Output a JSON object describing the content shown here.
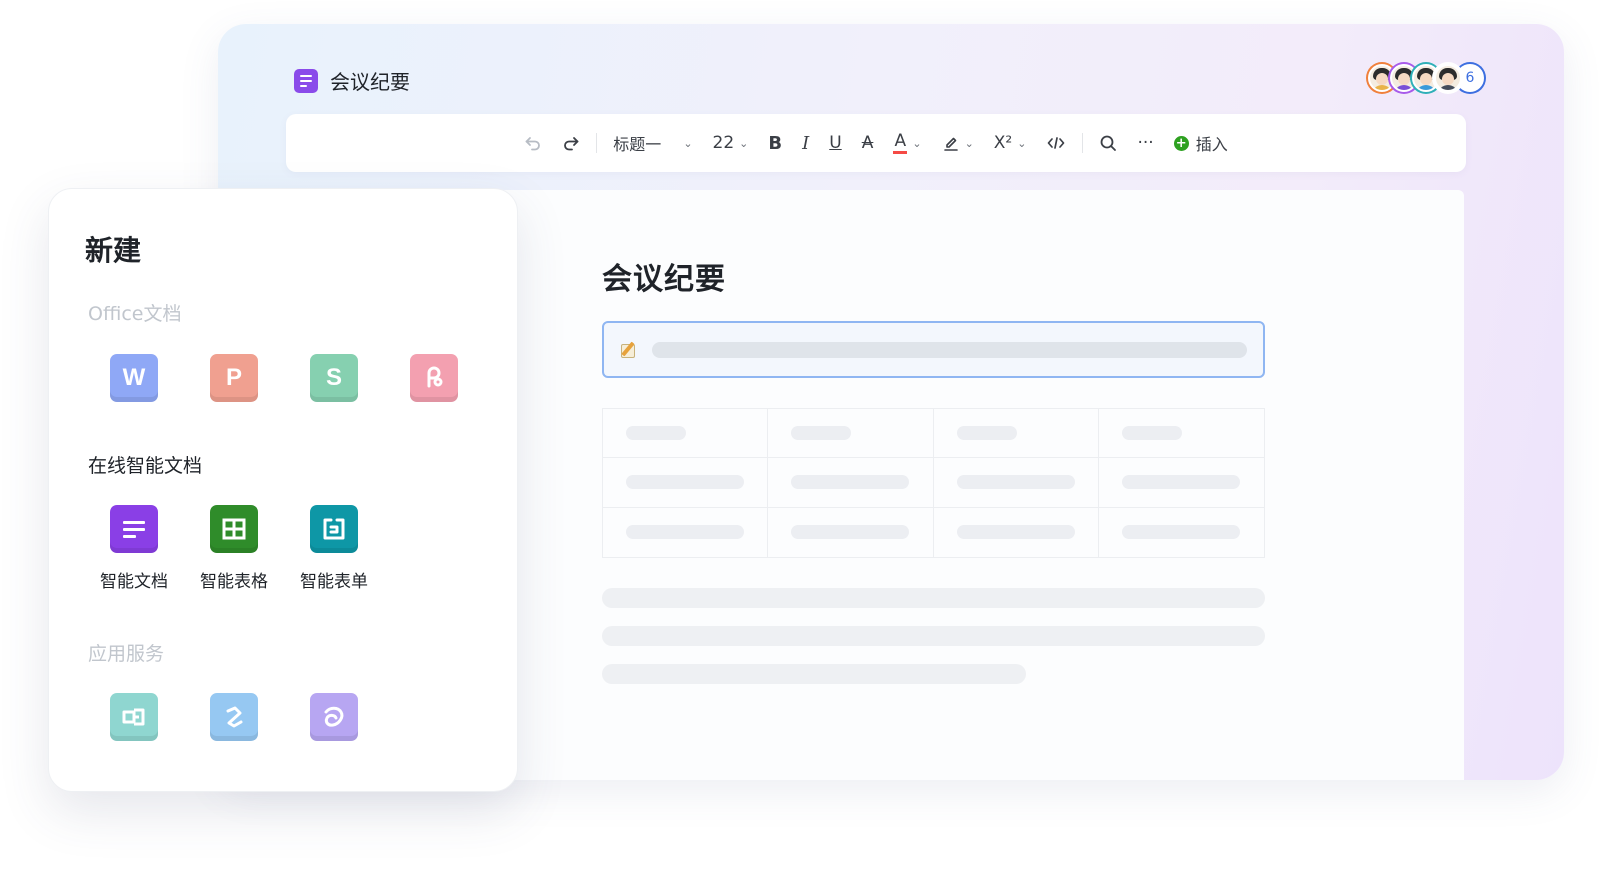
{
  "editor": {
    "title": "会议纪要",
    "page_heading": "会议纪要",
    "collaborator_extra_count": "6",
    "toolbar": {
      "heading_style": "标题一",
      "font_size": "22",
      "bold": "B",
      "italic": "I",
      "underline": "U",
      "strikethrough": "A",
      "font_color": "A",
      "superscript": "X²",
      "more": "···",
      "insert": "插入"
    }
  },
  "new_panel": {
    "title": "新建",
    "sections": {
      "office": {
        "label": "Office文档",
        "items": [
          {
            "glyph": "W",
            "color": "#8fa8f6"
          },
          {
            "glyph": "P",
            "color": "#f0a090"
          },
          {
            "glyph": "S",
            "color": "#86d0b0"
          },
          {
            "glyph": "",
            "color": "#f3a0b0"
          }
        ]
      },
      "online": {
        "label": "在线智能文档",
        "items": [
          {
            "label": "智能文档",
            "color": "#8a3fe6"
          },
          {
            "label": "智能表格",
            "color": "#2f8c2a"
          },
          {
            "label": "智能表单",
            "color": "#0e97a6"
          }
        ]
      },
      "apps": {
        "label": "应用服务",
        "items": [
          {
            "color": "#8fd6d0"
          },
          {
            "color": "#96c8f2"
          },
          {
            "color": "#b7a6f2"
          }
        ]
      }
    }
  },
  "colors": {
    "accent_blue": "#3d6fe0",
    "insert_green": "#2ea121",
    "doc_purple": "#8a4bea"
  }
}
